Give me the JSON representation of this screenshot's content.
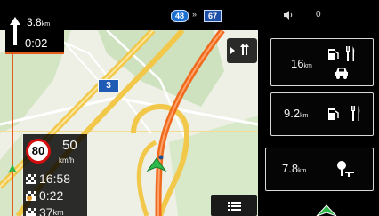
{
  "topbar": {
    "road_a": "48",
    "separator": "»",
    "road_b": "67",
    "volume_label": "0"
  },
  "next_turn": {
    "distance_value": "3.8",
    "distance_unit": "km",
    "time": "0:02",
    "arrow_icon": "straight-arrow-icon"
  },
  "map": {
    "road_shield": "3"
  },
  "trip_info": {
    "speed_limit": "80",
    "current_speed": "50",
    "speed_unit": "km/h",
    "eta": "16:58",
    "remaining_time": "0:22",
    "remaining_distance_value": "37",
    "remaining_distance_unit": "km"
  },
  "services": [
    {
      "distance_value": "16",
      "distance_unit": "km",
      "icons": [
        "fuel-icon",
        "restaurant-icon",
        "car-service-icon"
      ]
    },
    {
      "distance_value": "9.2",
      "distance_unit": "km",
      "icons": [
        "fuel-icon",
        "restaurant-icon"
      ]
    },
    {
      "distance_value": "7.8",
      "distance_unit": "km",
      "icons": [
        "rest-area-icon"
      ]
    }
  ],
  "colors": {
    "route": "#f06a1e",
    "accent": "#e25e1e",
    "speed_limit_ring": "#d40d0d",
    "road_yellow": "#f2c84b",
    "position_marker": "#2fb84a"
  }
}
